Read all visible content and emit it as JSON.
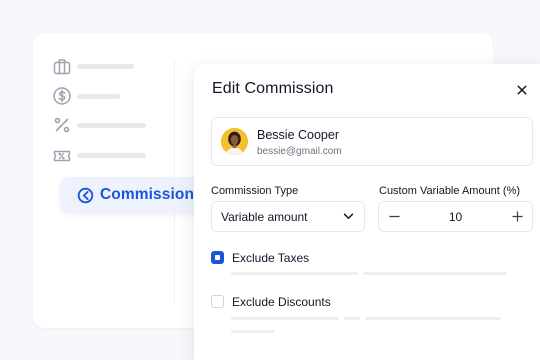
{
  "sidebar": {
    "items": [
      {
        "icon": "briefcase-icon"
      },
      {
        "icon": "dollar-icon"
      },
      {
        "icon": "percent-icon"
      },
      {
        "icon": "ticket-icon"
      }
    ],
    "active": {
      "icon": "commission-logo-icon",
      "label": "Commissions"
    }
  },
  "modal": {
    "title": "Edit Commission",
    "close_icon": "close-icon",
    "user": {
      "name": "Bessie Cooper",
      "email": "bessie@gmail.com"
    },
    "commission_type": {
      "label": "Commission Type",
      "value": "Variable amount"
    },
    "custom_amount": {
      "label": "Custom Variable Amount (%)",
      "value": "10"
    },
    "exclude_taxes": {
      "label": "Exclude Taxes",
      "checked": true
    },
    "exclude_discounts": {
      "label": "Exclude Discounts",
      "checked": false
    }
  },
  "colors": {
    "accent": "#1a56db",
    "avatar_bg": "#f5c02e"
  }
}
